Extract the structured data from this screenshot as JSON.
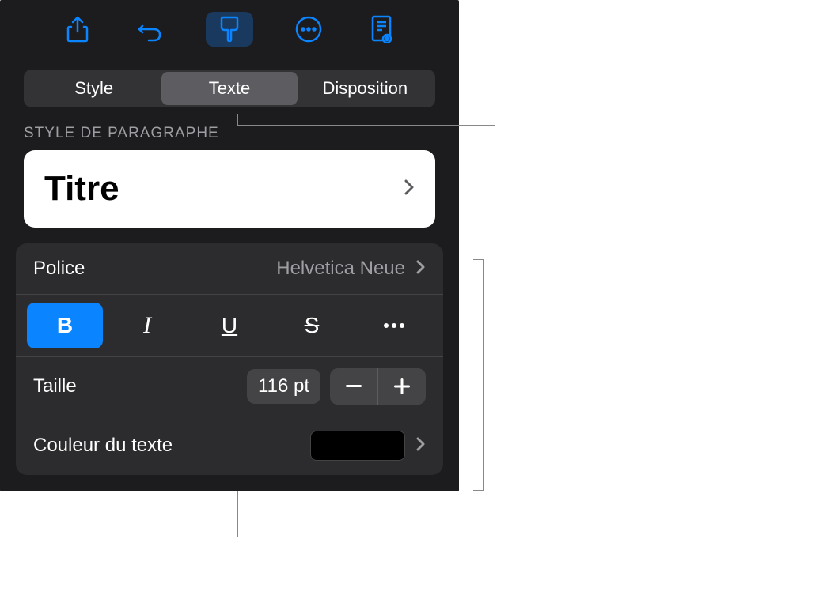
{
  "tabs": {
    "style": "Style",
    "text": "Texte",
    "layout": "Disposition"
  },
  "sectionHeader": "STYLE DE PARAGRAPHE",
  "paragraphStyle": "Titre",
  "font": {
    "label": "Police",
    "value": "Helvetica Neue"
  },
  "format": {
    "bold": "B",
    "italic": "I",
    "underline": "U",
    "strikethrough": "S"
  },
  "size": {
    "label": "Taille",
    "value": "116 pt"
  },
  "textColor": {
    "label": "Couleur du texte",
    "value": "#000000"
  }
}
